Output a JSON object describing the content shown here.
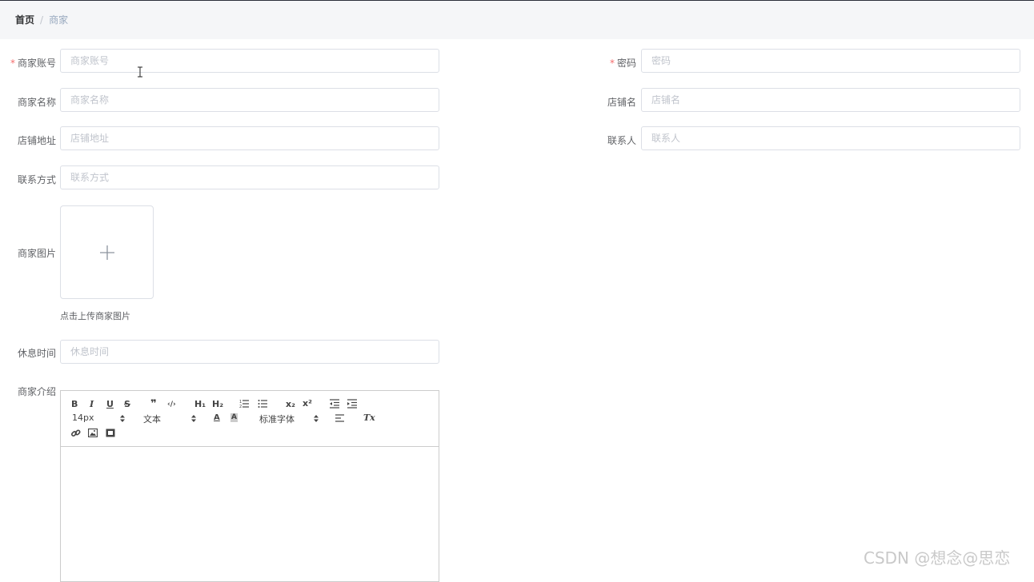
{
  "breadcrumb": {
    "home": "首页",
    "separator": "/",
    "current": "商家"
  },
  "form": {
    "account": {
      "label": "商家账号",
      "placeholder": "商家账号",
      "required_mark": "*"
    },
    "password": {
      "label": "密码",
      "placeholder": "密码",
      "required_mark": "*"
    },
    "merchant_name": {
      "label": "商家名称",
      "placeholder": "商家名称"
    },
    "shop_name": {
      "label": "店铺名",
      "placeholder": "店铺名"
    },
    "shop_address": {
      "label": "店铺地址",
      "placeholder": "店铺地址"
    },
    "contact_person": {
      "label": "联系人",
      "placeholder": "联系人"
    },
    "contact_method": {
      "label": "联系方式",
      "placeholder": "联系方式"
    },
    "merchant_image": {
      "label": "商家图片",
      "upload_tip": "点击上传商家图片",
      "plus_icon": "plus-icon"
    },
    "rest_time": {
      "label": "休息时间",
      "placeholder": "休息时间"
    },
    "intro": {
      "label": "商家介绍"
    }
  },
  "editor": {
    "toolbar": {
      "bold": "B",
      "italic": "I",
      "underline": "U",
      "strike": "S",
      "blockquote": "❞",
      "code": "‹/›",
      "h1": "H₁",
      "h2": "H₂",
      "ordered_list": "ordered-list-icon",
      "bullet_list": "bullet-list-icon",
      "subscript": "x₂",
      "superscript": "x²",
      "outdent": "outdent-icon",
      "indent": "indent-icon",
      "size_select": "14px",
      "header_select": "文本",
      "color": "A",
      "background": "A",
      "font_select": "标准字体",
      "align": "align-icon",
      "clean": "Tx",
      "link": "link-icon",
      "image": "image-icon",
      "video": "video-icon"
    }
  },
  "watermark": "CSDN @想念@思恋"
}
